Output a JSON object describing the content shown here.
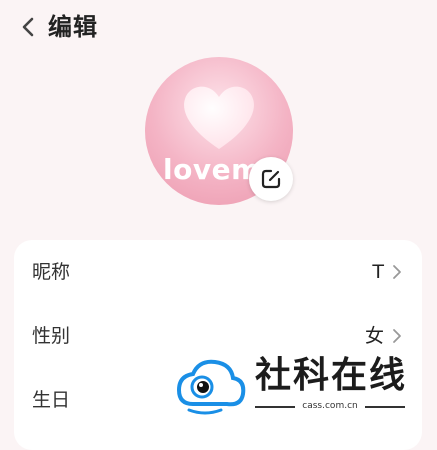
{
  "header": {
    "title": "编辑"
  },
  "avatar": {
    "text": "lovem"
  },
  "profile": {
    "rows": [
      {
        "label": "昵称",
        "value": "T"
      },
      {
        "label": "性别",
        "value": "女"
      },
      {
        "label": "生日",
        "value": ""
      }
    ]
  },
  "watermark": {
    "name": "社科在线",
    "url": "cass.com.cn"
  },
  "colors": {
    "background": "#fbf4f5",
    "avatar_pink": "#f4b4c5",
    "watermark_blue": "#1a8fe6"
  },
  "icons": [
    "back-chevron-icon",
    "heart-icon",
    "edit-icon",
    "chevron-right-icon",
    "cloud-eye-logo-icon"
  ]
}
